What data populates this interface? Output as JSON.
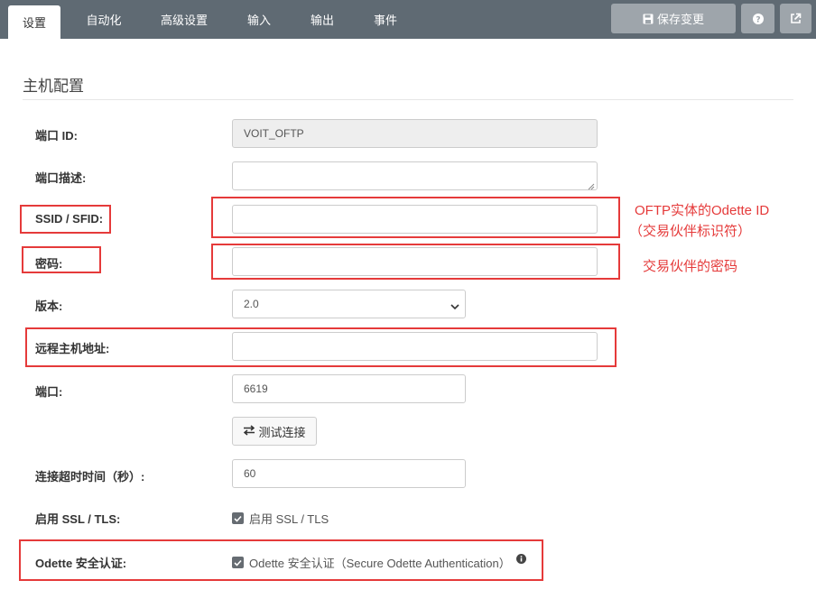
{
  "tabs": [
    {
      "label": "设置",
      "active": true
    },
    {
      "label": "自动化",
      "active": false
    },
    {
      "label": "高级设置",
      "active": false
    },
    {
      "label": "输入",
      "active": false
    },
    {
      "label": "输出",
      "active": false
    },
    {
      "label": "事件",
      "active": false
    }
  ],
  "toolbar": {
    "save_label": "保存变更",
    "help_icon": "question-icon",
    "external_icon": "external-link-icon"
  },
  "section": {
    "title": "主机配置"
  },
  "form": {
    "port_id": {
      "label": "端口 ID:",
      "value": "VOIT_OFTP"
    },
    "port_desc": {
      "label": "端口描述:",
      "value": ""
    },
    "ssid": {
      "label": "SSID / SFID:",
      "value": ""
    },
    "password": {
      "label": "密码:",
      "value": ""
    },
    "version": {
      "label": "版本:",
      "value": "2.0"
    },
    "remote_host": {
      "label": "远程主机地址:",
      "value": ""
    },
    "port": {
      "label": "端口:",
      "value": "6619"
    },
    "test_button": "测试连接",
    "timeout": {
      "label": "连接超时时间（秒）:",
      "value": "60"
    },
    "ssl": {
      "label": "启用 SSL / TLS:",
      "checkbox_label": "启用 SSL / TLS",
      "checked": true
    },
    "odette": {
      "label": "Odette 安全认证:",
      "checkbox_label": "Odette 安全认证（Secure Odette Authentication）",
      "checked": true
    }
  },
  "annotations": {
    "ssid_note_line1": "OFTP实体的Odette ID",
    "ssid_note_line2": "（交易伙伴标识符）",
    "password_note": "交易伙伴的密码"
  },
  "colors": {
    "topbar": "#5f6a73",
    "button": "#9ea5ab",
    "highlight": "#e53a3a"
  }
}
